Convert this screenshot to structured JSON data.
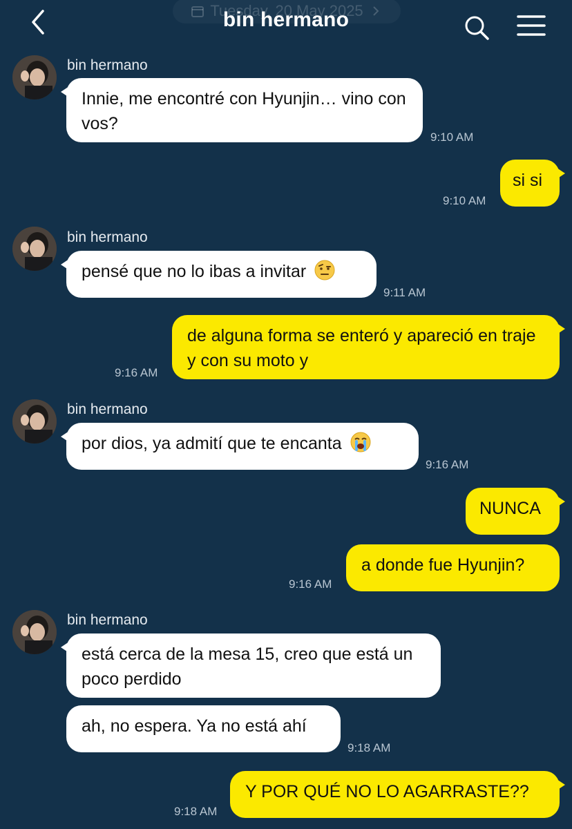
{
  "header": {
    "date": "Tuesday, 20 May 2025",
    "title": "bin hermano"
  },
  "colors": {
    "background": "#13314a",
    "incoming_bubble": "#ffffff",
    "outgoing_bubble": "#fbe900",
    "timestamp": "#b9c6d2"
  },
  "icons": {
    "back": "chevron-left-icon",
    "search": "search-icon",
    "menu": "menu-icon",
    "calendar": "calendar-icon",
    "date_chevron": "chevron-right-icon"
  },
  "messages": [
    {
      "sender": "bin hermano",
      "text": "Innie, me encontré con Hyunjin… vino con vos?",
      "time": "9:10 AM"
    },
    {
      "text": "si si",
      "time": "9:10 AM"
    },
    {
      "sender": "bin hermano",
      "text": "pensé que no lo ibas a invitar",
      "emoji": "raised-eyebrow-emoji",
      "time": "9:11 AM"
    },
    {
      "text": "de alguna forma se enteró y apareció en traje y con su moto y",
      "time": "9:16 AM"
    },
    {
      "sender": "bin hermano",
      "text": "por dios, ya admití que te encanta",
      "emoji": "loudly-crying-emoji",
      "time": "9:16 AM"
    },
    {
      "text": "NUNCA"
    },
    {
      "text": "a donde fue Hyunjin?",
      "time": "9:16 AM"
    },
    {
      "sender": "bin hermano",
      "text": "está cerca de la mesa 15, creo que está un poco perdido"
    },
    {
      "text": "ah, no espera. Ya no está ahí",
      "time": "9:18 AM"
    },
    {
      "text": "Y POR QUÉ NO LO AGARRASTE??",
      "time": "9:18 AM"
    }
  ]
}
